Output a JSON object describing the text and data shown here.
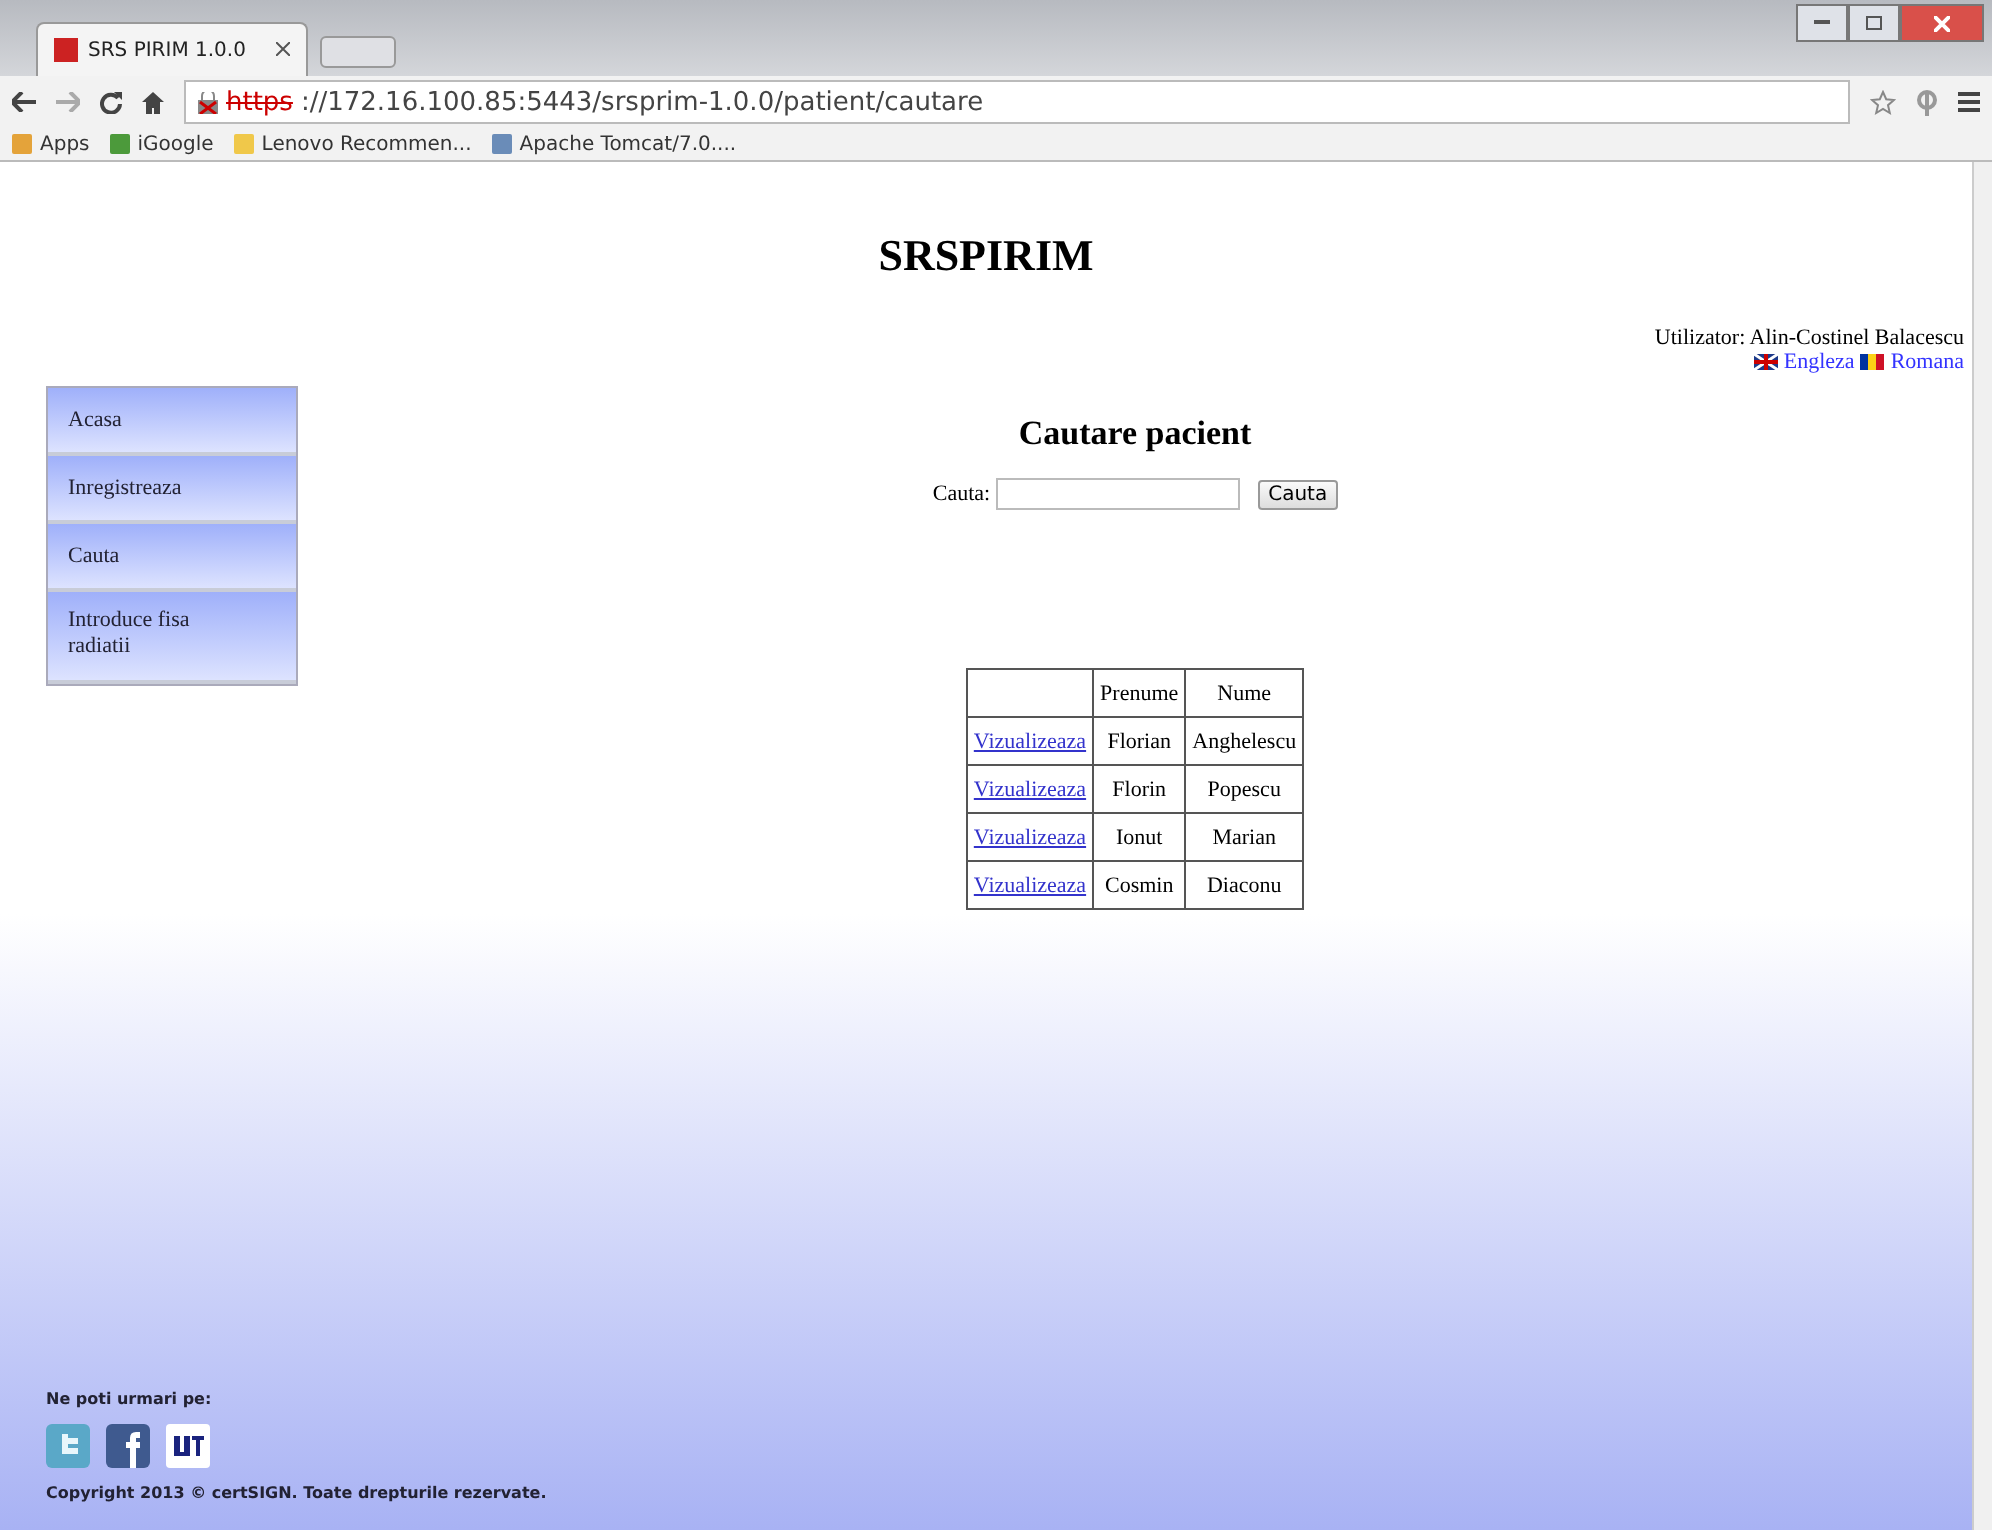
{
  "browser": {
    "tab_title": "SRS PIRIM 1.0.0",
    "url_scheme": "https",
    "url_rest": "://172.16.100.85:5443/srsprim-1.0.0/patient/cautare",
    "bookmarks": [
      "Apps",
      "iGoogle",
      "Lenovo Recommen...",
      "Apache Tomcat/7.0...."
    ]
  },
  "site_title": "SRSPIRIM",
  "user": "Utilizator: Alin-Costinel Balacescu",
  "languages": [
    "Engleza",
    "Romana"
  ],
  "menu": [
    "Acasa",
    "Inregistreaza",
    "Cauta",
    "Introduce fisa radiatii"
  ],
  "heading": "Cautare pacient",
  "search": {
    "label": "Cauta:",
    "button": "Cauta"
  },
  "table": {
    "columns": [
      "Prenume",
      "Nume"
    ],
    "rows": [
      {
        "link": "Vizualizeaza",
        "first": "Florian",
        "last": "Anghelescu"
      },
      {
        "link": "Vizualizeaza",
        "first": "Florin",
        "last": "Popescu"
      },
      {
        "link": "Vizualizeaza",
        "first": "Ionut",
        "last": "Marian"
      },
      {
        "link": "Vizualizeaza",
        "first": "Cosmin",
        "last": "Diaconu"
      }
    ]
  },
  "footer": {
    "follow": "Ne poti urmari pe:",
    "copyright": "Copyright 2013 © certSIGN. Toate drepturile rezervate."
  }
}
